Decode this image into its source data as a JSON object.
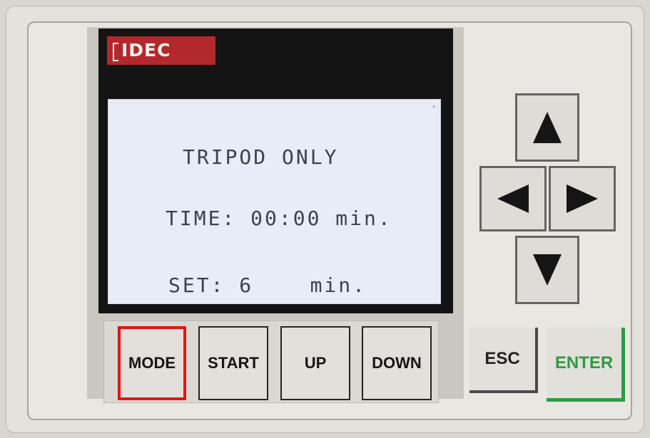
{
  "brand": {
    "logo_text": "IDEC"
  },
  "display": {
    "title": "TRIPOD ONLY",
    "time_line": "TIME: 00:00 min.",
    "set_line": "SET: 6    min."
  },
  "function_keys": {
    "mode": "MODE",
    "start": "START",
    "up": "UP",
    "down": "DOWN"
  },
  "nav_keys": {
    "up_icon": "up-arrow-icon",
    "left_icon": "left-arrow-icon",
    "right_icon": "right-arrow-icon",
    "down_icon": "down-arrow-icon"
  },
  "esc_label": "ESC",
  "enter_label": "ENTER",
  "colors": {
    "highlight": "#e31414",
    "enter_accent": "#2f9b44",
    "brand_red": "#b3282c",
    "lcd_background": "#e8ecf6"
  }
}
